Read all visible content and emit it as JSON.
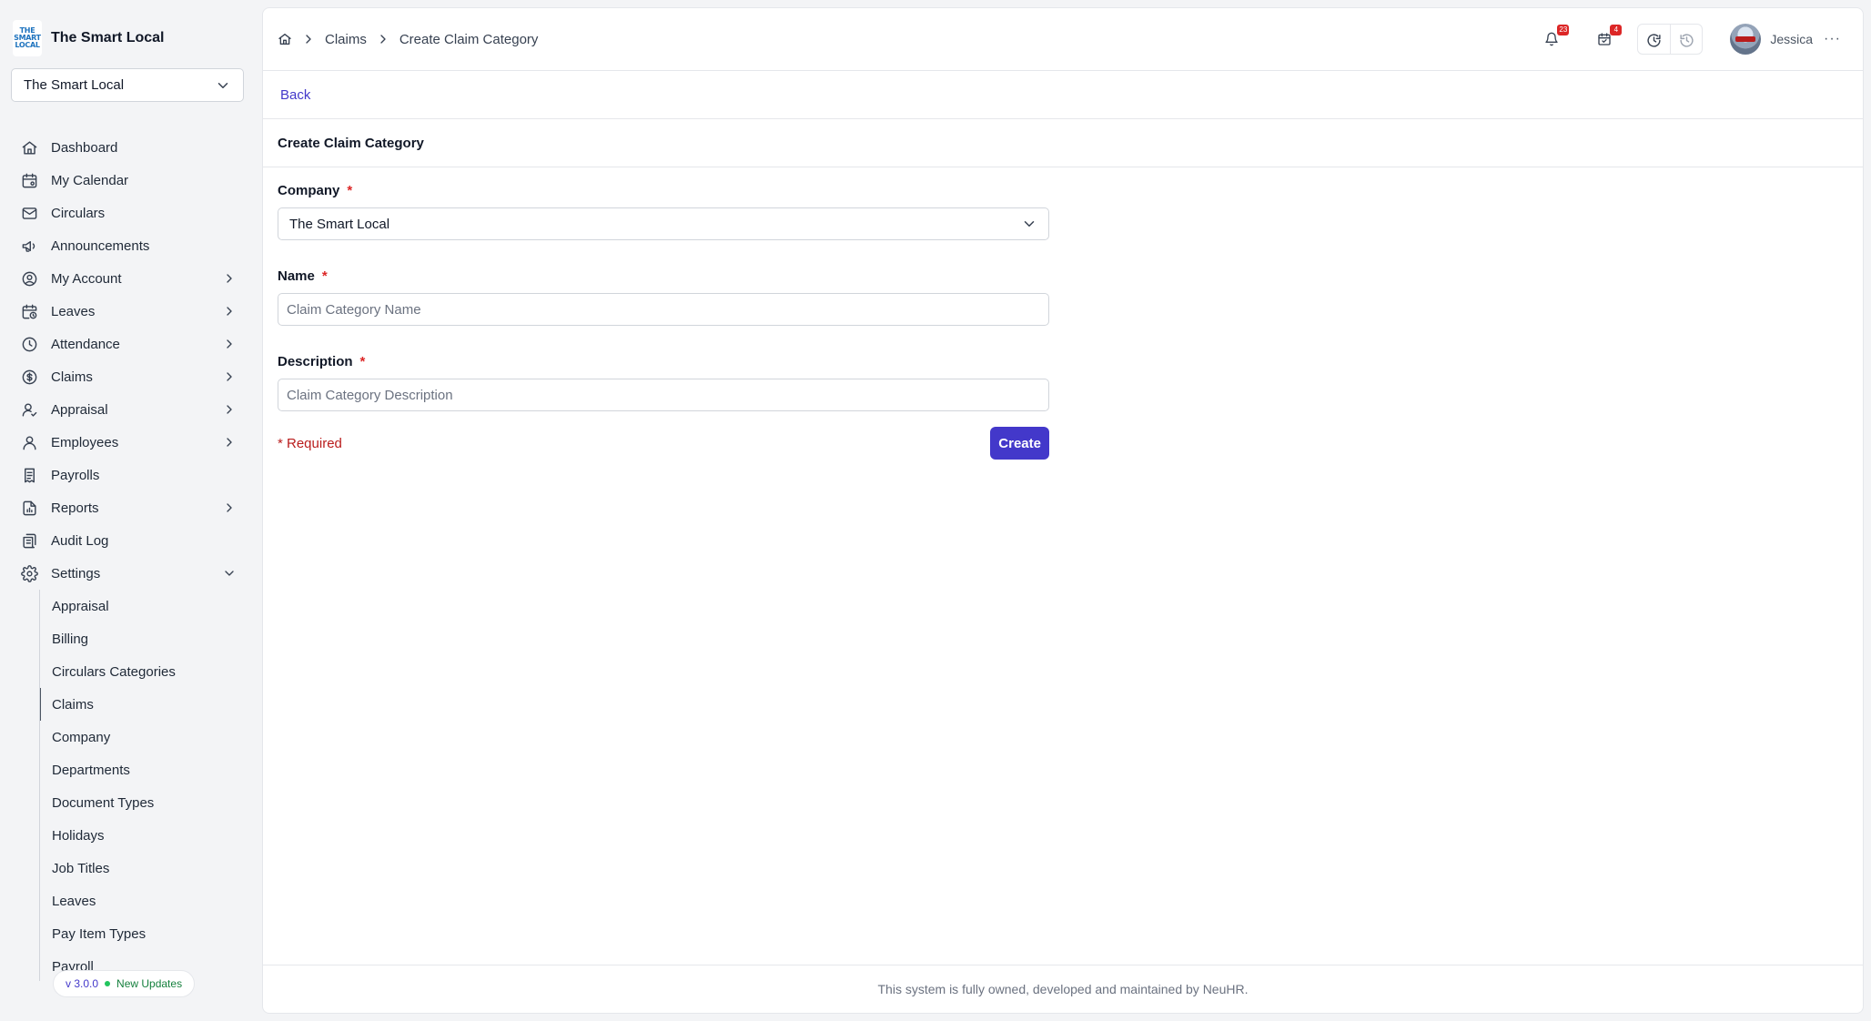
{
  "app": {
    "name": "The Smart Local",
    "logo_text": [
      "THE",
      "SMART",
      "LOCAL"
    ]
  },
  "company_switcher": {
    "value": "The Smart Local",
    "icon": "chevron-down-icon"
  },
  "sidebar": {
    "items": [
      {
        "label": "Dashboard",
        "icon": "home-icon",
        "expandable": false
      },
      {
        "label": "My Calendar",
        "icon": "calendar-icon",
        "expandable": false
      },
      {
        "label": "Circulars",
        "icon": "mail-icon",
        "expandable": false
      },
      {
        "label": "Announcements",
        "icon": "megaphone-icon",
        "expandable": false
      },
      {
        "label": "My Account",
        "icon": "user-circle-icon",
        "expandable": true
      },
      {
        "label": "Leaves",
        "icon": "calendar-clock-icon",
        "expandable": true
      },
      {
        "label": "Attendance",
        "icon": "clock-icon",
        "expandable": true
      },
      {
        "label": "Claims",
        "icon": "dollar-circle-icon",
        "expandable": true
      },
      {
        "label": "Appraisal",
        "icon": "user-check-icon",
        "expandable": true
      },
      {
        "label": "Employees",
        "icon": "user-icon",
        "expandable": true
      },
      {
        "label": "Payrolls",
        "icon": "receipt-icon",
        "expandable": false
      },
      {
        "label": "Reports",
        "icon": "file-chart-icon",
        "expandable": true
      },
      {
        "label": "Audit Log",
        "icon": "scroll-icon",
        "expandable": false
      },
      {
        "label": "Settings",
        "icon": "gear-icon",
        "expandable": true,
        "expanded": true
      }
    ],
    "settings_sub_items": [
      {
        "label": "Appraisal"
      },
      {
        "label": "Billing"
      },
      {
        "label": "Circulars Categories"
      },
      {
        "label": "Claims",
        "active": true
      },
      {
        "label": "Company"
      },
      {
        "label": "Departments"
      },
      {
        "label": "Document Types"
      },
      {
        "label": "Holidays"
      },
      {
        "label": "Job Titles"
      },
      {
        "label": "Leaves"
      },
      {
        "label": "Pay Item Types"
      },
      {
        "label": "Payroll"
      }
    ],
    "version": {
      "label": "v 3.0.0",
      "updates_label": "New Updates"
    }
  },
  "breadcrumb": {
    "home_icon": "home-icon",
    "items": [
      "Claims",
      "Create Claim Category"
    ]
  },
  "topbar": {
    "notifications_count": "23",
    "tasks_count": "4",
    "user_name": "Jessica",
    "more_icon": "more-horizontal-icon"
  },
  "page": {
    "back_label": "Back",
    "title": "Create Claim Category"
  },
  "form": {
    "company": {
      "label": "Company",
      "required_mark": "*",
      "value": "The Smart Local"
    },
    "name": {
      "label": "Name",
      "required_mark": "*",
      "value": "",
      "placeholder": "Claim Category Name"
    },
    "description": {
      "label": "Description",
      "required_mark": "*",
      "value": "",
      "placeholder": "Claim Category Description"
    },
    "required_note": "* Required",
    "submit_label": "Create"
  },
  "footer": {
    "text": "This system is fully owned, developed and maintained by NeuHR."
  },
  "colors": {
    "accent": "#4338ca",
    "danger": "#dc2626",
    "border": "#e5e7eb",
    "sidebar_bg": "#f3f4f6"
  }
}
